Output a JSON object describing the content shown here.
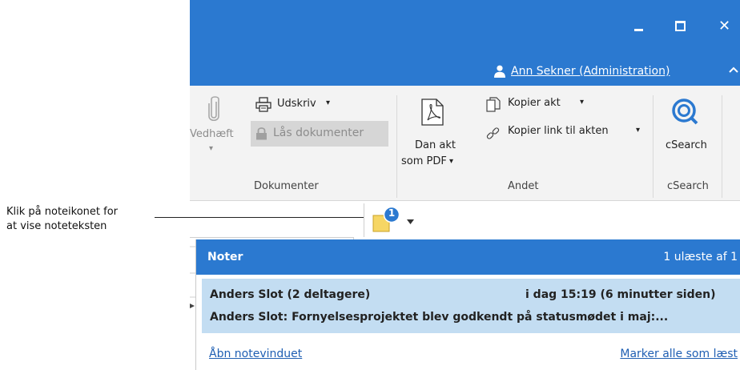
{
  "window": {
    "minimize_icon": "minimize-icon",
    "maximize_icon": "maximize-icon",
    "close_glyph": "✕",
    "user_name": "Ann Sekner (Administration)"
  },
  "ribbon": {
    "attach_label": "Vedhæft",
    "print_label": "Udskriv",
    "lock_label": "Lås dokumenter",
    "pdf_label_line1": "Dan akt",
    "pdf_label_line2": "som PDF",
    "copy_act_label": "Kopier akt",
    "copy_link_label": "Kopier link til akten",
    "csearch_label": "cSearch",
    "groups": {
      "documents": "Dokumenter",
      "other": "Andet",
      "csearch": "cSearch"
    },
    "dropdown_glyph": "▾"
  },
  "annotation": {
    "line1": "Klik på noteikonet for",
    "line2": "at vise noteteksten"
  },
  "note_button": {
    "badge_count": "1"
  },
  "notes_popup": {
    "title": "Noter",
    "unread": "1 ulæste af 1",
    "item": {
      "author": "Anders Slot (2 deltagere)",
      "time": "i dag 15:19 (6 minutter siden)",
      "text": "Anders Slot: Fornyelsesprojektet blev godkendt på statusmødet i maj:..."
    },
    "open_link": "Åbn notevinduet",
    "mark_all_link": "Marker alle som læst"
  },
  "colors": {
    "accent": "#2b79d0",
    "selected_item": "#c3ddf2",
    "note_yellow": "#f6d664",
    "badge": "#2b79d0"
  }
}
